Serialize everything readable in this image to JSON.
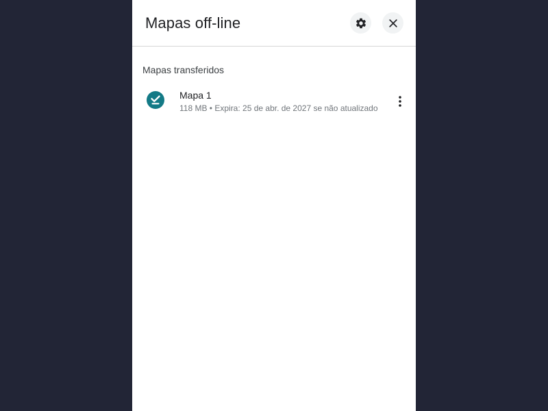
{
  "header": {
    "title": "Mapas off-line",
    "settings_icon": "gear-icon",
    "close_icon": "close-icon"
  },
  "section": {
    "title": "Mapas transferidos"
  },
  "maps": [
    {
      "name": "Mapa 1",
      "size": "118 MB",
      "separator": " • ",
      "expiry": "Expira: 25 de abr. de 2027 se não atualizado",
      "status_icon": "downloaded-check-icon",
      "menu_icon": "more-vert-icon"
    }
  ],
  "colors": {
    "backdrop": "#222536",
    "panel": "#ffffff",
    "accent": "#137a86",
    "button_bg": "#f1f3f4"
  }
}
